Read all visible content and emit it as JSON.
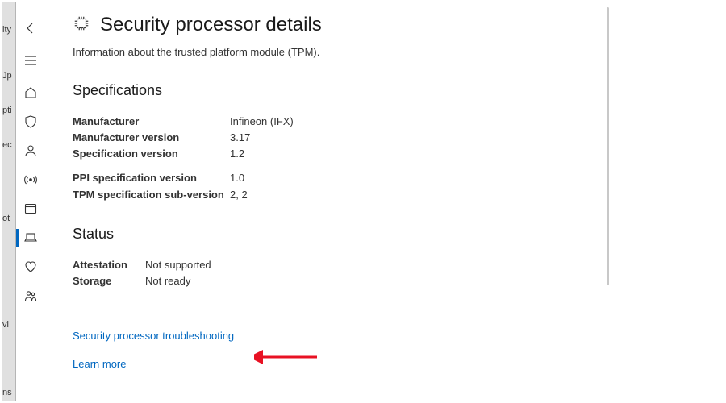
{
  "bgLabels": [
    "ity",
    "Jp",
    "pti",
    "ec",
    "ot",
    "vi",
    "ns"
  ],
  "page": {
    "title": "Security processor details",
    "subtitle": "Information about the trusted platform module (TPM)."
  },
  "specifications": {
    "title": "Specifications",
    "rows1": [
      {
        "label": "Manufacturer",
        "value": "Infineon (IFX)"
      },
      {
        "label": "Manufacturer version",
        "value": "3.17"
      },
      {
        "label": "Specification version",
        "value": "1.2"
      }
    ],
    "rows2": [
      {
        "label": "PPI specification version",
        "value": "1.0"
      },
      {
        "label": "TPM specification sub-version",
        "value": "2, 2"
      }
    ]
  },
  "status": {
    "title": "Status",
    "rows": [
      {
        "label": "Attestation",
        "value": "Not supported"
      },
      {
        "label": "Storage",
        "value": "Not ready"
      }
    ]
  },
  "links": {
    "troubleshooting": "Security processor troubleshooting",
    "learn": "Learn more"
  }
}
